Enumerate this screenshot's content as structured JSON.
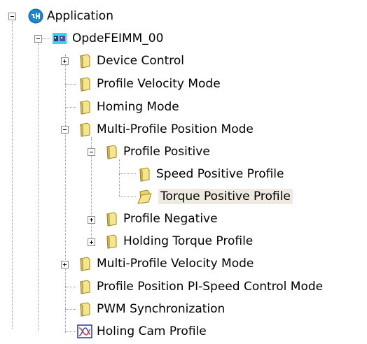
{
  "tree": {
    "nodes": [
      {
        "id": "application",
        "label": "Application",
        "icon": "application-globe-icon",
        "toggle": "minus"
      },
      {
        "id": "opdefeimm",
        "label": "OpdeFEIMM_00",
        "icon": "device-module-icon",
        "toggle": "minus"
      },
      {
        "id": "device-control",
        "label": "Device Control",
        "icon": "folder-icon",
        "toggle": "plus"
      },
      {
        "id": "profile-velocity-mode",
        "label": "Profile Velocity Mode",
        "icon": "folder-icon",
        "toggle": null
      },
      {
        "id": "homing-mode",
        "label": "Homing Mode",
        "icon": "folder-icon",
        "toggle": null
      },
      {
        "id": "multi-profile-position-mode",
        "label": "Multi-Profile Position Mode",
        "icon": "folder-icon",
        "toggle": "minus"
      },
      {
        "id": "profile-positive",
        "label": "Profile Positive",
        "icon": "folder-icon",
        "toggle": "minus"
      },
      {
        "id": "speed-positive-profile",
        "label": "Speed Positive Profile",
        "icon": "folder-icon",
        "toggle": null
      },
      {
        "id": "torque-positive-profile",
        "label": "Torque Positive Profile",
        "icon": "folder-open-icon",
        "toggle": null,
        "selected": true
      },
      {
        "id": "profile-negative",
        "label": "Profile Negative",
        "icon": "folder-icon",
        "toggle": "plus"
      },
      {
        "id": "holding-torque-profile",
        "label": "Holding Torque Profile",
        "icon": "folder-icon",
        "toggle": "plus"
      },
      {
        "id": "multi-profile-velocity-mode",
        "label": "Multi-Profile Velocity Mode",
        "icon": "folder-icon",
        "toggle": "plus"
      },
      {
        "id": "profile-position-pi-speed",
        "label": "Profile Position PI-Speed Control Mode",
        "icon": "folder-icon",
        "toggle": null
      },
      {
        "id": "pwm-synchronization",
        "label": "PWM Synchronization",
        "icon": "folder-icon",
        "toggle": null
      },
      {
        "id": "holing-cam-profile",
        "label": "Holing Cam Profile",
        "icon": "cam-chart-icon",
        "toggle": null
      }
    ]
  },
  "colors": {
    "selection_background": "#efeae0",
    "folder_fill": "#f5e68c",
    "folder_stroke": "#a0861f",
    "application_icon": "#1a86d6",
    "device_icon_background": "#32d8f0"
  }
}
